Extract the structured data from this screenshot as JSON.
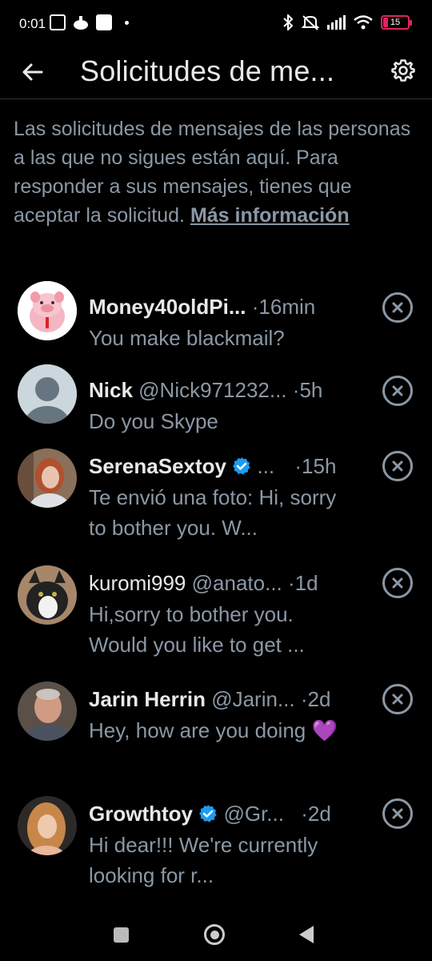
{
  "status_bar": {
    "time": "0:01",
    "battery": "15",
    "battery_color": "#e0245e"
  },
  "header": {
    "title": "Solicitudes de me...",
    "back_icon": "arrow-left-icon",
    "settings_icon": "gear-icon"
  },
  "info": {
    "text": "Las solicitudes de mensajes de las personas a las que no sigues están aquí. Para responder a sus mensajes, tienes que aceptar la solicitud. ",
    "link": "Más información"
  },
  "requests": [
    {
      "name": "Money40oldPi...",
      "handle": "",
      "time": "·16min",
      "message": "You make blackmail?",
      "verified": false
    },
    {
      "name": "Nick",
      "handle": "@Nick971232...",
      "time": "·5h",
      "message": "Do you Skype",
      "verified": false
    },
    {
      "name": "SerenaSextoy",
      "handle": "...",
      "time": "·15h",
      "message": "Te envió una foto: Hi, sorry to bother you. W...",
      "verified": true
    },
    {
      "name": "kuromi999",
      "handle": "@anato...",
      "time": "·1d",
      "message": "Hi,sorry to bother you. Would you like to get ...",
      "verified": false
    },
    {
      "name": "Jarin Herrin",
      "handle": "@Jarin...",
      "time": "·2d",
      "message": "Hey, how are you doing 💜",
      "verified": false
    },
    {
      "name": "Growthtoy",
      "handle": "@Gr...",
      "time": "·2d",
      "message": "Hi dear!!! We're currently looking for r...",
      "verified": true
    }
  ],
  "colors": {
    "background": "#000000",
    "primary_text": "#e7e9ea",
    "secondary_text": "#8b98a5",
    "verified": "#1d9bf0"
  }
}
